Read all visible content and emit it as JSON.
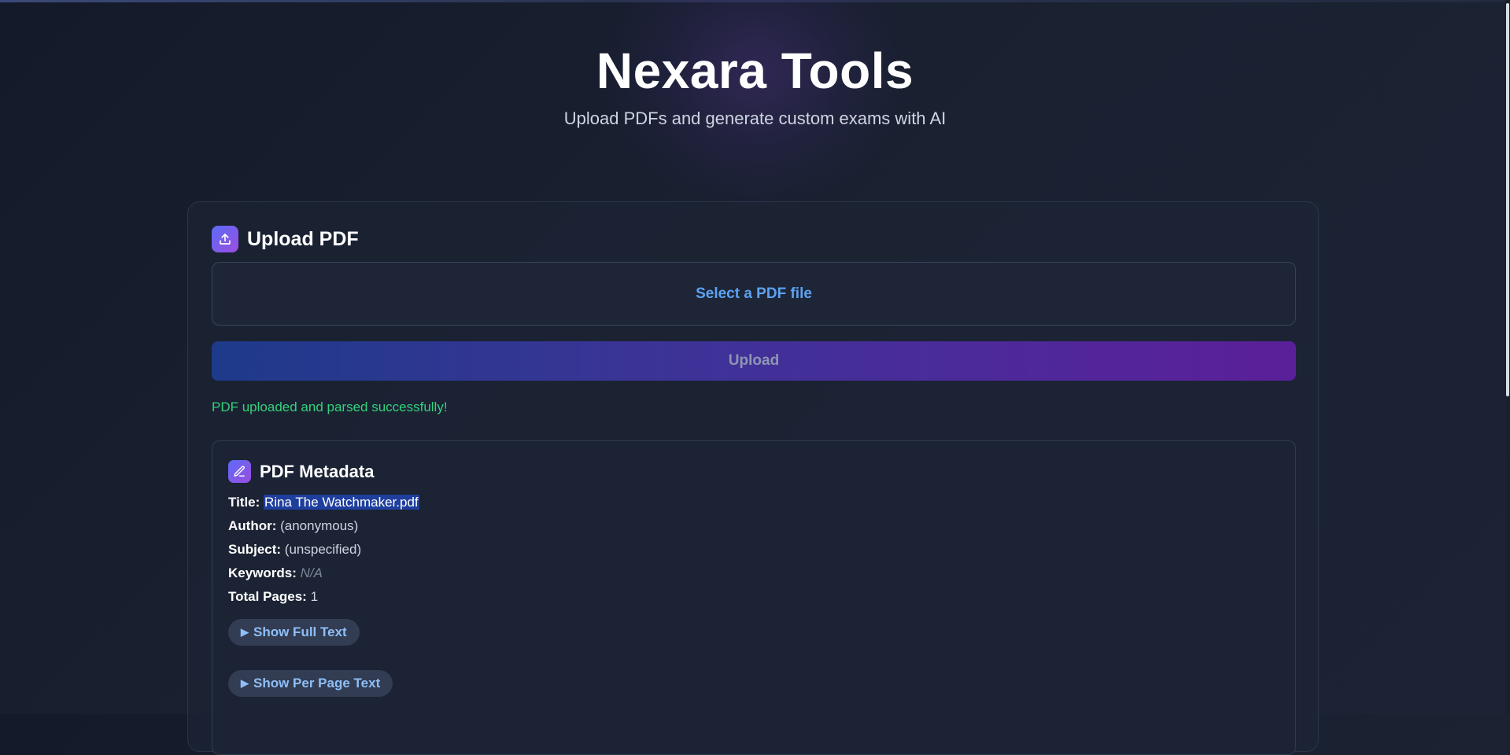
{
  "header": {
    "title": "Nexara Tools",
    "subtitle": "Upload PDFs and generate custom exams with AI"
  },
  "upload_card": {
    "title": "Upload PDF",
    "icon": "upload-icon",
    "dropzone_label": "Select a PDF file",
    "upload_button_label": "Upload",
    "status_message": "PDF uploaded and parsed successfully!",
    "status_color": "#34d27b"
  },
  "metadata": {
    "title": "PDF Metadata",
    "icon": "pencil-icon",
    "fields": {
      "title_label": "Title:",
      "title_value": "Rina The Watchmaker.pdf",
      "author_label": "Author:",
      "author_value": "(anonymous)",
      "subject_label": "Subject:",
      "subject_value": "(unspecified)",
      "keywords_label": "Keywords:",
      "keywords_value": "N/A",
      "pages_label": "Total Pages:",
      "pages_value": "1"
    },
    "show_full_text_label": "Show Full Text",
    "show_per_page_label": "Show Per Page Text"
  },
  "colors": {
    "accent_blue": "#5da2f2",
    "badge_gradient_start": "#5b6cf6",
    "badge_gradient_end": "#9b4de0"
  }
}
